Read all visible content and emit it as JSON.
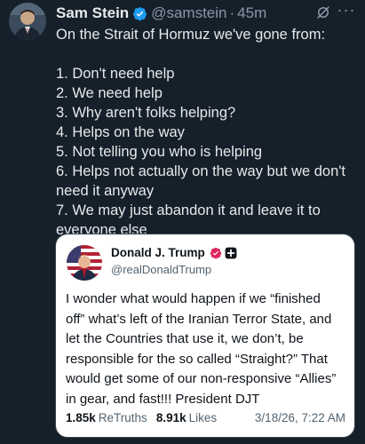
{
  "post": {
    "author": {
      "display_name": "Sam Stein",
      "handle": "@samstein",
      "verified": true
    },
    "separator": "·",
    "time": "45m",
    "more_label": "···",
    "icons": {
      "verified": "verified-badge-icon",
      "grok": "grok-icon",
      "more": "more-options-icon"
    },
    "text_lines": [
      "On the Strait of Hormuz we've gone from:",
      "",
      "1. Don't need help",
      "2. We need help",
      "3. Why aren't folks helping?",
      "4. Helps on the way",
      "5. Not telling you who is helping",
      "6. Helps not actually on the way but we don't",
      "need it anyway",
      "7. We may just abandon it and leave it to",
      "everyone else"
    ]
  },
  "quote": {
    "author": {
      "display_name": "Donald J. Trump",
      "handle": "@realDonaldTrump"
    },
    "text_lines": [
      "I wonder what would happen if we “finished",
      "off” what’s left of the Iranian Terror State, and",
      "let the Countries that use it, we don’t, be",
      "responsible for the so called “Straight?” That",
      "would get some of our non-responsive “Allies”",
      "in gear, and fast!!! President DJT"
    ],
    "stats": {
      "retruths_count": "1.85k",
      "retruths_label": "ReTruths",
      "likes_count": "8.91k",
      "likes_label": "Likes"
    },
    "date": "3/18/26, 7:22 AM"
  },
  "colors": {
    "background": "#15202b",
    "text": "#e7e9ea",
    "muted": "#8b98a5",
    "verified": "#1d9bf0",
    "quote_bg": "#ffffff",
    "quote_badge": "#e0245e"
  }
}
